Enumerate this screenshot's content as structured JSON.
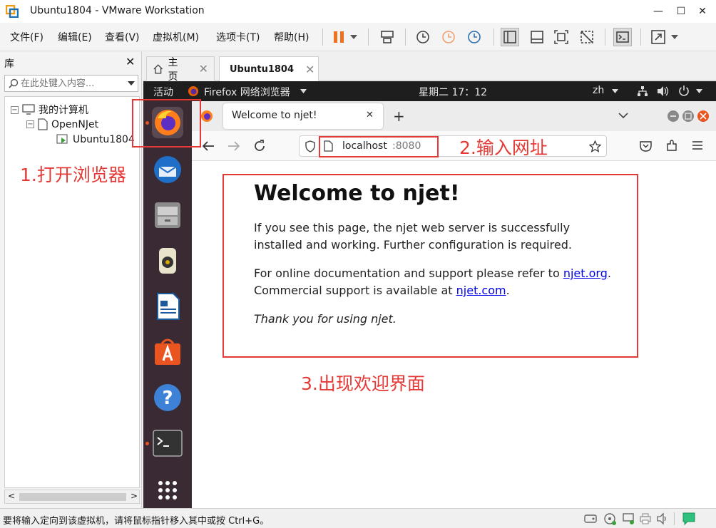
{
  "window": {
    "title": "Ubuntu1804 - VMware Workstation",
    "min": "—",
    "max": "☐",
    "close": "✕"
  },
  "menu": [
    "文件(F)",
    "编辑(E)",
    "查看(V)",
    "虚拟机(M)",
    "选项卡(T)",
    "帮助(H)"
  ],
  "library": {
    "title": "库",
    "close": "✕",
    "search_placeholder": "在此处键入内容...",
    "tree": [
      {
        "label": "我的计算机",
        "expander": "−"
      },
      {
        "label": "OpenNJet",
        "expander": "−"
      },
      {
        "label": "Ubuntu1804"
      }
    ],
    "scroll_left": "<",
    "scroll_right": ">"
  },
  "tabs": [
    {
      "label": "主页",
      "close": "✕"
    },
    {
      "label": "Ubuntu1804",
      "close": "✕"
    }
  ],
  "gnome": {
    "activities": "活动",
    "app_menu": "Firefox 网络浏览器",
    "clock": "星期二 17：12",
    "lang": "zh"
  },
  "firefox": {
    "tab_title": "Welcome to njet!",
    "tab_close": "✕",
    "new_tab": "+",
    "url_host": "localhost",
    "url_port": ":8080"
  },
  "page": {
    "heading": "Welcome to njet!",
    "p1": "If you see this page, the njet web server is successfully installed and working. Further configuration is required.",
    "p2_pre": "For online documentation and support please refer to ",
    "p2_link1": "njet.org",
    "p2_mid": ".",
    "p2_line2_pre": "Commercial support is available at ",
    "p2_link2": "njet.com",
    "p2_end": ".",
    "p3": "Thank you for using njet."
  },
  "annotations": {
    "step1": "1.打开浏览器",
    "step2": "2.输入网址",
    "step3": "3.出现欢迎界面"
  },
  "status": {
    "text": "要将输入定向到该虚拟机，请将鼠标指针移入其中或按 Ctrl+G。"
  },
  "colors": {
    "annotation_red": "#e53935",
    "ubuntu_orange": "#e95420",
    "dock_bg": "#3a2a33"
  }
}
